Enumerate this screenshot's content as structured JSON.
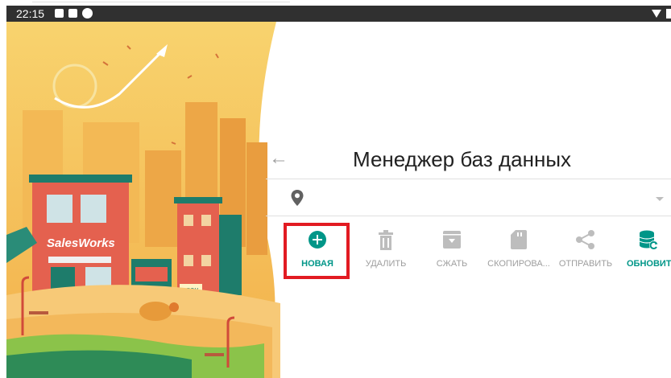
{
  "status_bar": {
    "time": "22:15"
  },
  "art": {
    "shop_sign": "SalesWorks",
    "kiosk_sign": "apeн"
  },
  "header": {
    "back_symbol": "←",
    "title": "Менеджер баз данных"
  },
  "location_select": {
    "value": ""
  },
  "toolbar": {
    "items": [
      {
        "label": "НОВАЯ",
        "icon": "add-circle-icon",
        "active": true
      },
      {
        "label": "УДАЛИТЬ",
        "icon": "trash-icon",
        "active": false
      },
      {
        "label": "СЖАТЬ",
        "icon": "archive-icon",
        "active": false
      },
      {
        "label": "СКОПИРОВА...",
        "icon": "sd-card-icon",
        "active": false
      },
      {
        "label": "ОТПРАВИТЬ",
        "icon": "share-icon",
        "active": false
      },
      {
        "label": "ОБНОВИТЬ",
        "icon": "database-refresh-icon",
        "active": true
      }
    ]
  },
  "colors": {
    "accent": "#009688",
    "highlight_border": "#e21b22",
    "disabled": "#9e9e9e",
    "status_bar": "#303030"
  }
}
